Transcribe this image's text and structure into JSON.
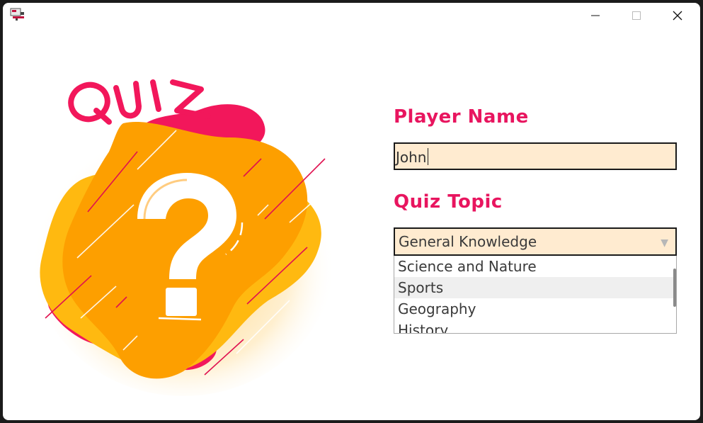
{
  "window": {
    "controls": [
      "minimize",
      "maximize",
      "close"
    ]
  },
  "form": {
    "player_name_label": "Player Name",
    "player_name_value": "John",
    "quiz_topic_label": "Quiz Topic",
    "selected_topic": "General Knowledge",
    "topic_options": [
      "Science and Nature",
      "Sports",
      "Geography",
      "History"
    ],
    "hovered_option": "Sports"
  },
  "illustration": {
    "title_text": "QUIZ",
    "symbol": "question-mark"
  },
  "colors": {
    "accent": "#e8155f",
    "input_bg": "#ffebd0",
    "orange": "#fd9f00",
    "yellow": "#ffb910",
    "pink": "#f2175b"
  }
}
